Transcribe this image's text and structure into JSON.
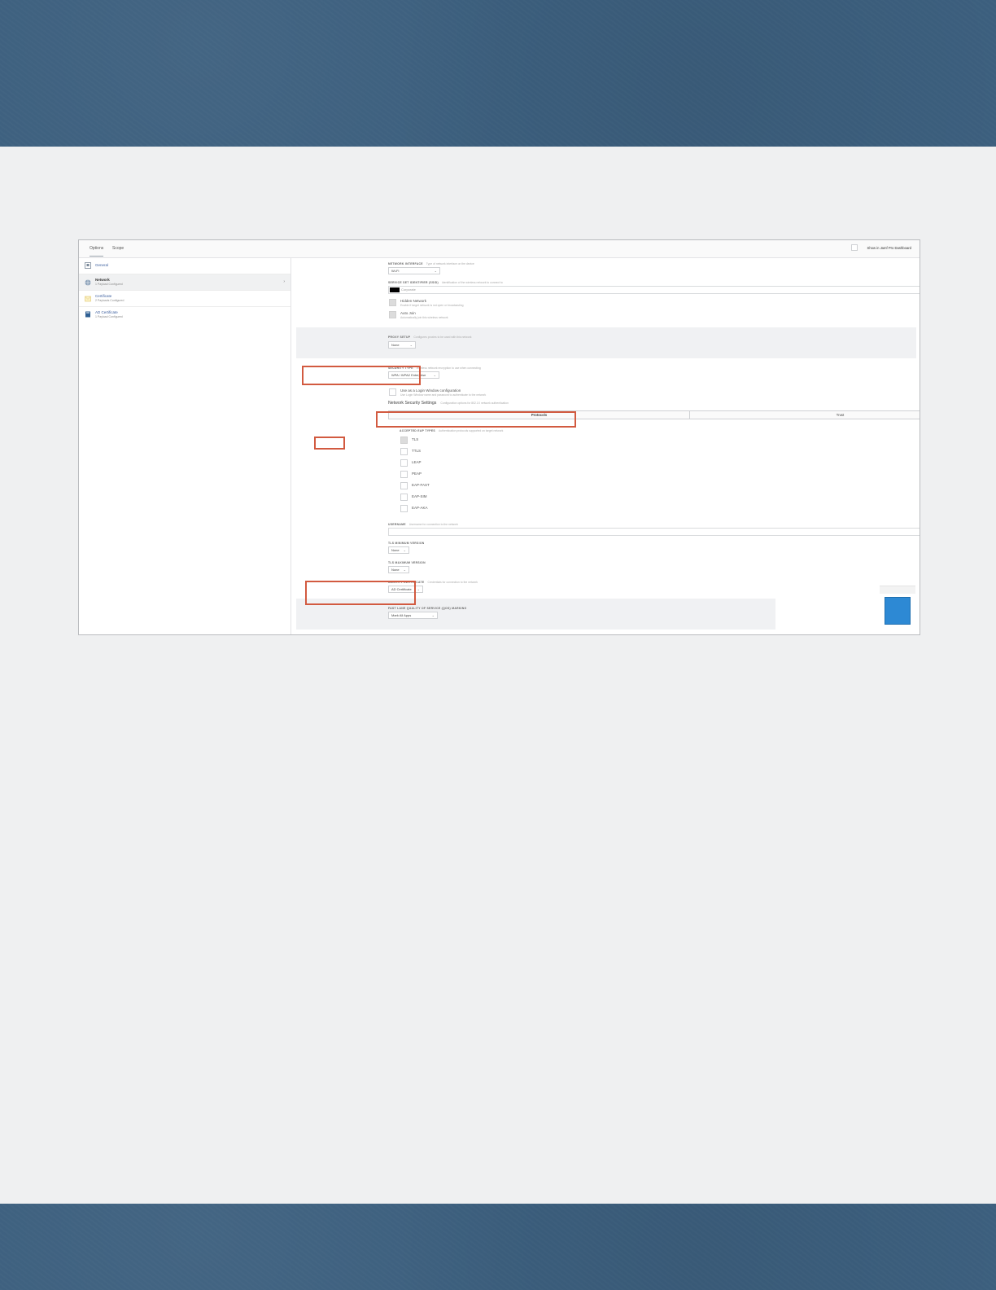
{
  "colors": {
    "highlight": "#d25a40",
    "link": "#3c5f9e",
    "band": "#3c5f7e",
    "thumb": "#2d89d4"
  },
  "tabs": [
    {
      "label": "Options"
    },
    {
      "label": "Scope"
    }
  ],
  "dashboard": {
    "label": "Show in Jamf Pro Dashboard"
  },
  "sidebar": {
    "items": [
      {
        "title": "General",
        "subtitle": "",
        "icon": "general-icon"
      },
      {
        "title": "Network",
        "subtitle": "1 Payload Configured",
        "icon": "globe-icon"
      },
      {
        "title": "Certificate",
        "subtitle": "2 Payloads Configured",
        "icon": "certificate-icon"
      },
      {
        "title": "AD Certificate",
        "subtitle": "1 Payload Configured",
        "icon": "ad-certificate-icon"
      }
    ],
    "chevron": "›"
  },
  "form": {
    "network_interface": {
      "label": "NETWORK INTERFACE",
      "desc": "Type of network interface on the device",
      "value": "Wi-Fi"
    },
    "ssid": {
      "label": "SERVICE SET IDENTIFIER (SSID)",
      "desc": "Identification of the wireless network to connect to",
      "value": "Corporate"
    },
    "hidden_network": {
      "label": "Hidden Network",
      "desc": "Enable if target network is not open or broadcasting"
    },
    "auto_join": {
      "label": "Auto Join",
      "desc": "Automatically join this wireless network"
    },
    "proxy_setup": {
      "label": "PROXY SETUP",
      "desc": "Configures proxies to be used with this network",
      "value": "None"
    },
    "security_type": {
      "label": "SECURITY TYPE",
      "desc": "Wireless network encryption to use when connecting",
      "value": "WPA / WPA2 Enterprise"
    },
    "login_window": {
      "label": "Use as a Login Window configuration",
      "desc": "Use Login Window name and password to authenticate to the network"
    },
    "nss": {
      "title": "Network Security Settings",
      "desc": "Configuration options for 802.1X network authentication"
    },
    "segments": [
      {
        "label": "Protocols"
      },
      {
        "label": "Trust"
      }
    ],
    "eap": {
      "label": "ACCEPTED EAP TYPES",
      "desc": "Authentication protocols supported on target network",
      "types": [
        "TLS",
        "TTLS",
        "LEAP",
        "PEAP",
        "EAP-FAST",
        "EAP-SIM",
        "EAP-AKA"
      ]
    },
    "username": {
      "label": "USERNAME",
      "desc": "Username for connection to the network"
    },
    "tls_min": {
      "label": "TLS MINIMUM VERSION",
      "value": "None"
    },
    "tls_max": {
      "label": "TLS MAXIMUM VERSION",
      "value": "None"
    },
    "identity_cert": {
      "label": "IDENTITY CERTIFICATE",
      "desc": "Credentials for connection to the network",
      "value": "AD Certificate"
    },
    "qos": {
      "label": "FAST LANE QUALITY OF SERVICE (QOS) MARKING",
      "value": "Mark All Apps"
    }
  },
  "caret": "⌄"
}
